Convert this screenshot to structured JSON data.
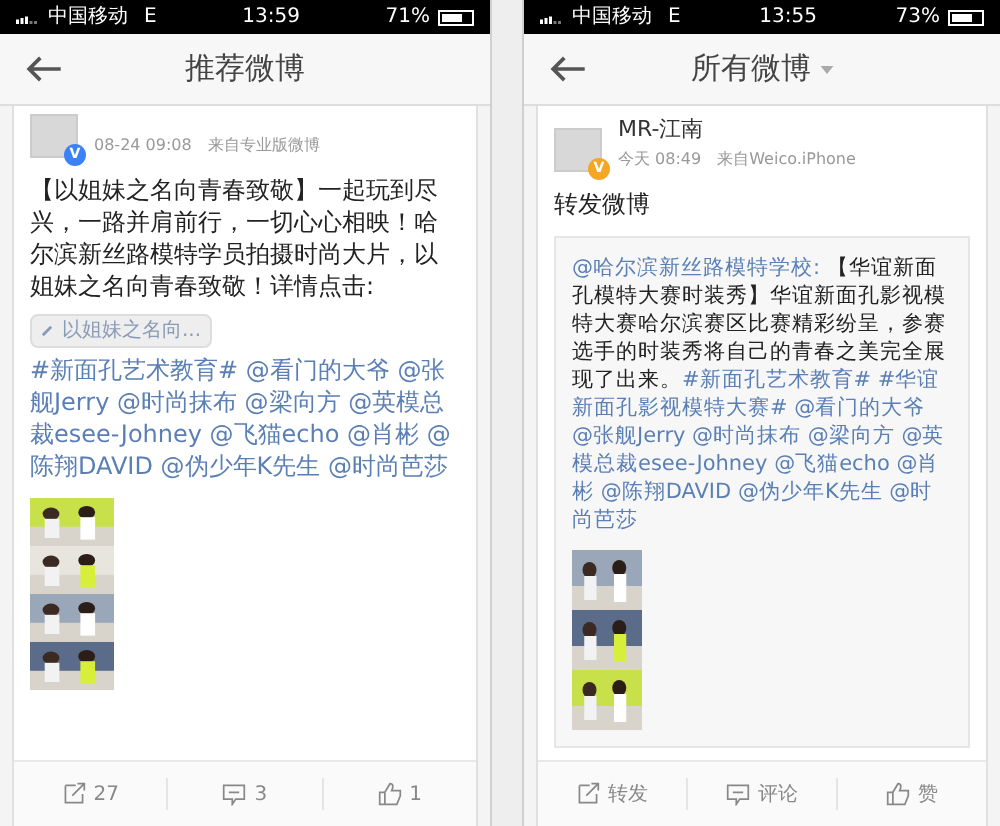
{
  "phones": [
    {
      "status": {
        "carrier": "中国移动",
        "network": "E",
        "time": "13:59",
        "battery": "71%"
      },
      "header": {
        "title": "推荐微博",
        "dropdown": false
      },
      "post": {
        "badge": {
          "text": "V",
          "color": "#3b82f6"
        },
        "date": "08-24 09:08",
        "source": "来自专业版微博",
        "body": [
          {
            "kind": "text",
            "text": "【以姐妹之名向青春致敬】一起玩到尽兴，一路并肩前行，一切心心相映！哈尔滨新丝路模特学员拍摄时尚大片，以姐妹之名向青春致敬！详情点击:"
          },
          {
            "kind": "chip",
            "text": "以姐妹之名向..."
          },
          {
            "kind": "link",
            "text": "#新面孔艺术教育# @看门的大爷 @张舰Jerry @时尚抹布 @梁向方 @英模总裁esee-Johney @飞猫echo @肖彬 @陈翔DAVID @伪少年K先生 @时尚芭莎"
          }
        ]
      },
      "actions": [
        "27",
        "3",
        "1"
      ]
    },
    {
      "status": {
        "carrier": "中国移动",
        "network": "E",
        "time": "13:55",
        "battery": "73%"
      },
      "header": {
        "title": "所有微博",
        "dropdown": true
      },
      "post": {
        "author": "MR-江南",
        "badge": {
          "text": "V",
          "color": "#f5a623"
        },
        "date": "今天 08:49",
        "source": "来自Weico.iPhone",
        "body": [
          {
            "kind": "text",
            "text": "转发微博"
          }
        ],
        "quote": [
          {
            "kind": "link",
            "text": "@哈尔滨新丝路模特学校:"
          },
          {
            "kind": "text",
            "text": "【华谊新面孔模特大赛时装秀】华谊新面孔影视模特大赛哈尔滨赛区比赛精彩纷呈，参赛选手的时装秀将自己的青春之美完全展现了出来。"
          },
          {
            "kind": "link",
            "text": "#新面孔艺术教育# #华谊新面孔影视模特大赛# @看门的大爷 @张舰Jerry @时尚抹布 @梁向方 @英模总裁esee-Johney @飞猫echo @肖彬 @陈翔DAVID @伪少年K先生 @时尚芭莎"
          }
        ]
      },
      "actions": [
        "转发",
        "评论",
        "赞"
      ]
    }
  ]
}
